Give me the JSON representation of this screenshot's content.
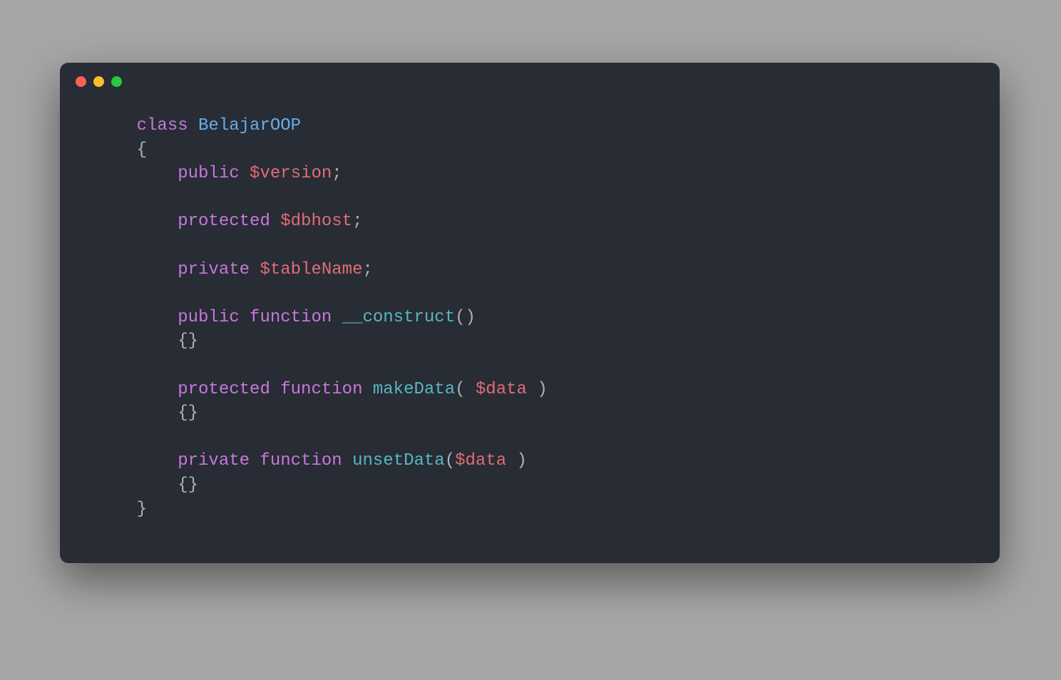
{
  "colors": {
    "window_bg": "#282c34",
    "page_bg": "#a6a6a6",
    "red": "#ff5f57",
    "yellow": "#febc2e",
    "green": "#28c840",
    "keyword": "#c678dd",
    "classname": "#61afef",
    "function": "#56b6c2",
    "variable": "#e06c75",
    "default": "#abb2bf"
  },
  "code": {
    "indent1": "    ",
    "indent2": "        ",
    "kw_class": "class",
    "class_name": "BelajarOOP",
    "brace_open": "{",
    "brace_close": "}",
    "empty_braces": "{}",
    "kw_public": "public",
    "kw_protected": "protected",
    "kw_private": "private",
    "kw_function": "function",
    "var_version": "$version",
    "var_dbhost": "$dbhost",
    "var_tableName": "$tableName",
    "var_data": "$data",
    "fn_construct": "__construct",
    "fn_makeData": "makeData",
    "fn_unsetData": "unsetData",
    "semicolon": ";",
    "paren_open": "(",
    "paren_close": ")",
    "space": " "
  }
}
